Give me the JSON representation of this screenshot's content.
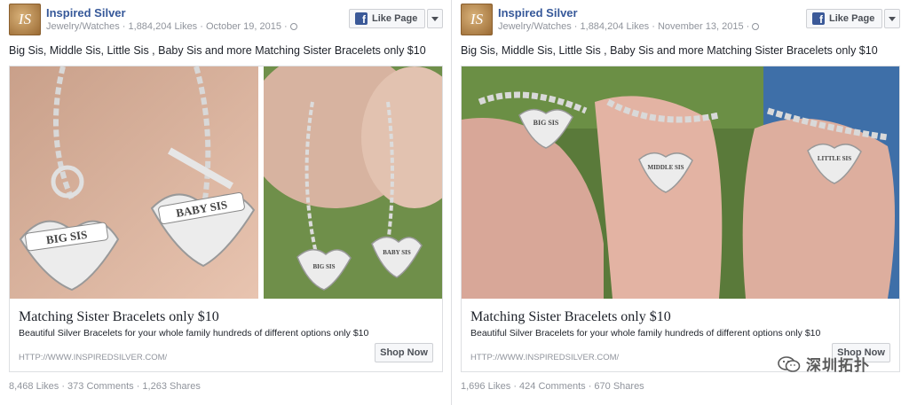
{
  "posts": [
    {
      "page_name": "Inspired Silver",
      "logo_text": "IS",
      "category": "Jewelry/Watches",
      "likes": "1,884,204 Likes",
      "date": "October 19, 2015",
      "like_button": "Like Page",
      "text": "Big Sis, Middle Sis, Little Sis , Baby Sis and more Matching Sister Bracelets only $10",
      "headline": "Matching Sister Bracelets only $10",
      "description": "Beautiful Silver Bracelets for your whole family hundreds of different options only $10",
      "url": "HTTP://WWW.INSPIREDSILVER.COM/",
      "cta": "Shop Now",
      "stats": {
        "likes": "8,468 Likes",
        "comments": "373 Comments",
        "shares": "1,263 Shares"
      },
      "charm_labels": [
        "BIG SIS",
        "BABY SIS",
        "BIG SIS",
        "BABY SIS"
      ]
    },
    {
      "page_name": "Inspired Silver",
      "logo_text": "IS",
      "category": "Jewelry/Watches",
      "likes": "1,884,204 Likes",
      "date": "November 13, 2015",
      "like_button": "Like Page",
      "text": "Big Sis, Middle Sis, Little Sis , Baby Sis and more Matching Sister Bracelets only $10",
      "headline": "Matching Sister Bracelets only $10",
      "description": "Beautiful Silver Bracelets for your whole family hundreds of different options only $10",
      "url": "HTTP://WWW.INSPIREDSILVER.COM/",
      "cta": "Shop Now",
      "stats": {
        "likes": "1,696 Likes",
        "comments": "424 Comments",
        "shares": "670 Shares"
      },
      "charm_labels": [
        "BIG SIS",
        "MIDDLE SIS",
        "LITTLE SIS"
      ]
    }
  ],
  "watermark": {
    "text": "深圳拓扑",
    "icon": "wechat-icon"
  },
  "icons": {
    "like": "facebook-f-icon",
    "dropdown": "caret-down-icon",
    "privacy": "globe-icon"
  },
  "colors": {
    "brand_blue": "#3b5998",
    "link_blue": "#365899",
    "meta_gray": "#90949c"
  }
}
